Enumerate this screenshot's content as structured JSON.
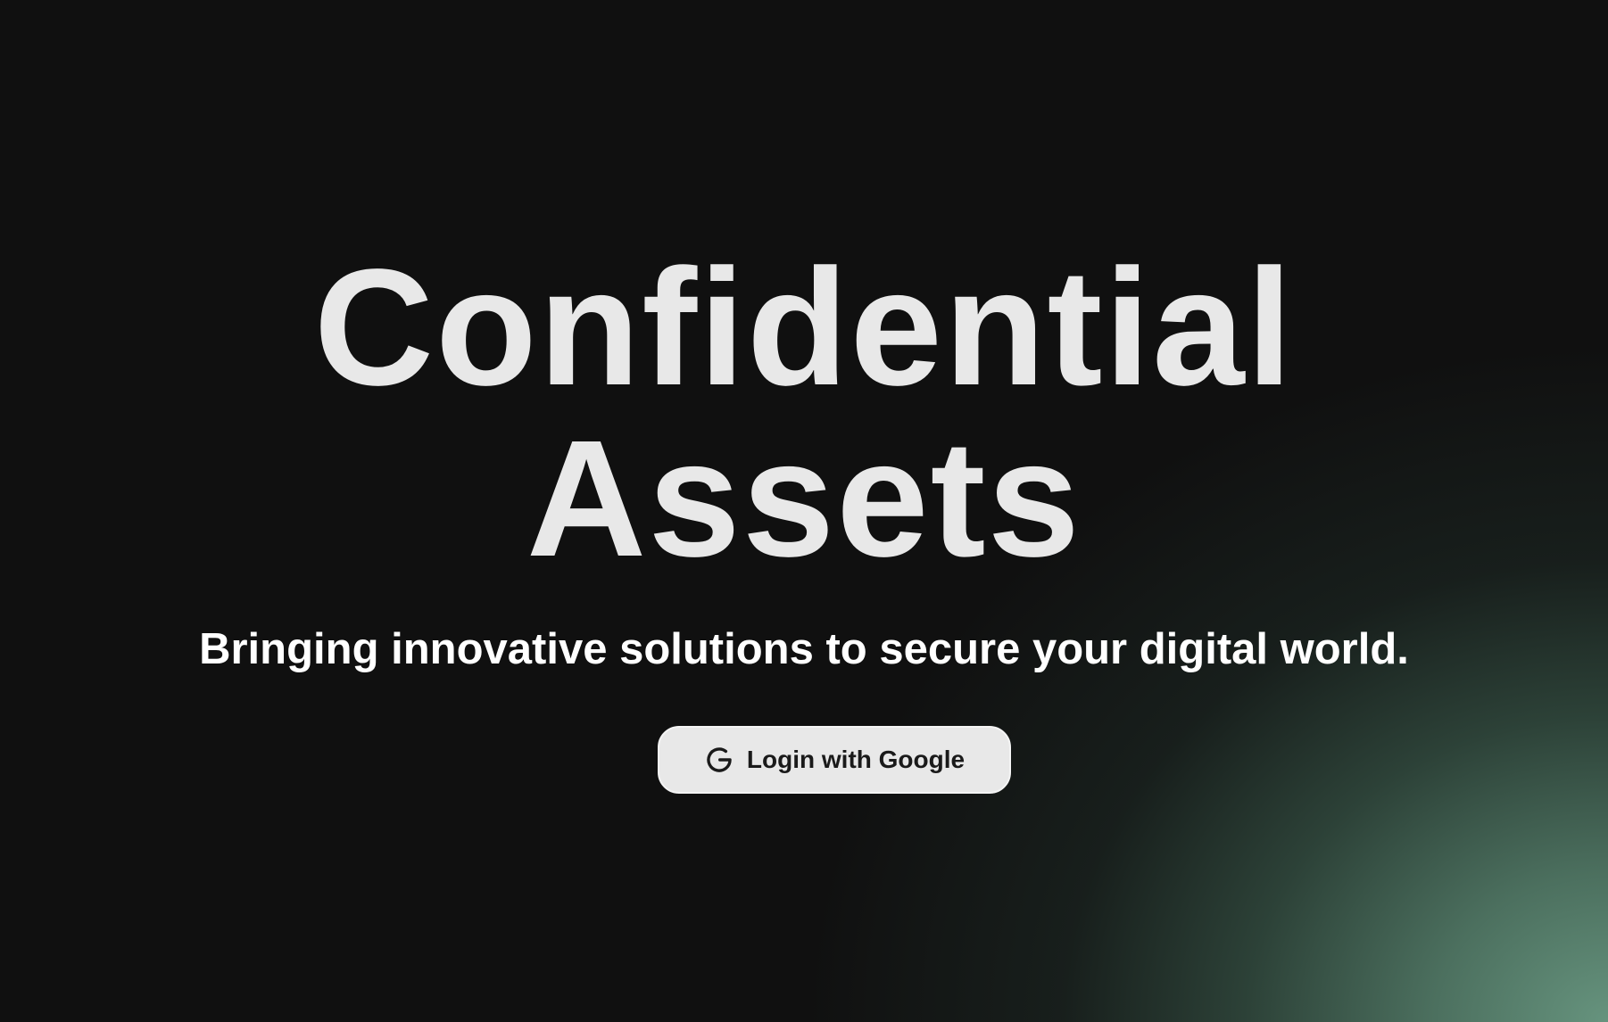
{
  "hero": {
    "title_line1": "Confidential",
    "title_line2": "Assets",
    "tagline": "Bringing innovative solutions to secure your digital world."
  },
  "login": {
    "label": "Login with Google",
    "icon": "google-icon"
  },
  "colors": {
    "background": "#101010",
    "glow": "#6a9a84",
    "title": "#e8e8e8",
    "button_bg": "#e8e8e8",
    "button_text": "#1a1a1a"
  }
}
